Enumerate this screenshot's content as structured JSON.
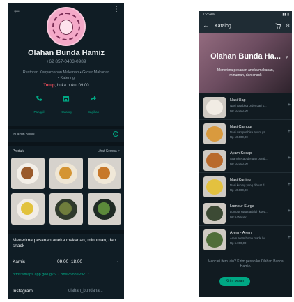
{
  "colors": {
    "accent": "#00a884",
    "closed": "#ea4c5a",
    "background": "#101d25"
  },
  "left_profile": {
    "name": "Olahan Bunda Hamiz",
    "phone": "+62 857-0403-0989",
    "category": "Restoran Kenyamanan Makanan • Grosir Makanan • Katering",
    "hours_status": "Tutup",
    "hours_rest": ", buka pukul 09.00",
    "actions": [
      {
        "label": "Panggil",
        "icon": "phone-icon"
      },
      {
        "label": "Katalog",
        "icon": "storefront-icon"
      },
      {
        "label": "Bagikan",
        "icon": "share-icon"
      }
    ],
    "about": "Ini akun bisnis.",
    "products_heading": "Produk",
    "products_see_all": "Lihat Semua >",
    "description": "Menerima pesanan aneka makanan, minuman, dan snack",
    "day": "Kamis",
    "time": "09.00–18.00",
    "link": "https://maps.app.goo.gl/6CLBhsPSohePtR17",
    "instagram_label": "Instagram",
    "instagram_value": "olahan_bundaha..."
  },
  "right_catalog": {
    "status_time": "7:26 AM",
    "title": "Katalog",
    "banner_name": "Olahan Bunda Ha...",
    "banner_desc": "Menerima pesanan aneka makanan, minuman, dan snack",
    "items": [
      {
        "name": "Nasi Uap",
        "desc": "Nasi uap bisa order dari s...",
        "price": "Rp 10.000,00"
      },
      {
        "name": "Nasi Campur",
        "desc": "Nasi campur bisa ayam ya...",
        "price": "Rp 10.000,00"
      },
      {
        "name": "Ayam Kecap",
        "desc": "Ayam kecap dengan bumb...",
        "price": "Rp 10.000,00"
      },
      {
        "name": "Nasi Kuning",
        "desc": "Nasi kuning yang dibuat d...",
        "price": "Rp 10.000,00"
      },
      {
        "name": "Lumpur Surga",
        "desc": "Lumpur surga adalah kued...",
        "price": "Rp 5.000,00"
      },
      {
        "name": "Arem - Arem",
        "desc": "Arem arem home made bu...",
        "price": "Rp 5.000,00"
      }
    ],
    "footer": "Mencari item lain? Kirim pesan ke Olahan Bunda Hamiz.",
    "button": "Kirim pesan"
  }
}
